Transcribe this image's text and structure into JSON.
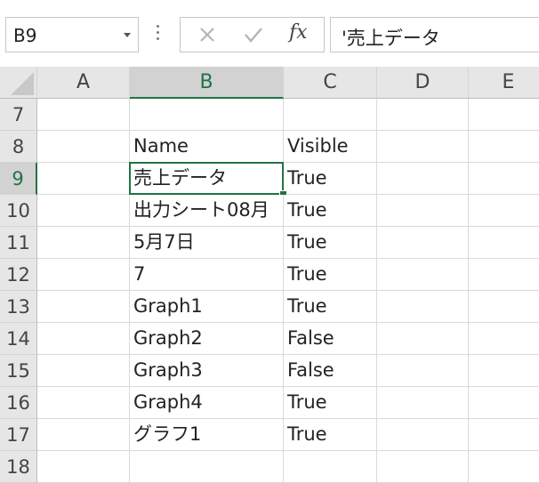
{
  "name_box": {
    "value": "B9"
  },
  "formula_bar": {
    "fx_label": "fx",
    "content": "'売上データ"
  },
  "columns": [
    {
      "label": "A"
    },
    {
      "label": "B"
    },
    {
      "label": "C"
    },
    {
      "label": "D"
    },
    {
      "label": "E"
    }
  ],
  "rows": [
    {
      "num": "7",
      "cells": [
        "",
        "",
        "",
        "",
        ""
      ]
    },
    {
      "num": "8",
      "cells": [
        "",
        "Name",
        "Visible",
        "",
        ""
      ]
    },
    {
      "num": "9",
      "cells": [
        "",
        "売上データ",
        "True",
        "",
        ""
      ]
    },
    {
      "num": "10",
      "cells": [
        "",
        "出力シート08月",
        "True",
        "",
        ""
      ]
    },
    {
      "num": "11",
      "cells": [
        "",
        "5月7日",
        "True",
        "",
        ""
      ]
    },
    {
      "num": "12",
      "cells": [
        "",
        "7",
        "True",
        "",
        ""
      ]
    },
    {
      "num": "13",
      "cells": [
        "",
        "Graph1",
        "True",
        "",
        ""
      ]
    },
    {
      "num": "14",
      "cells": [
        "",
        "Graph2",
        "False",
        "",
        ""
      ]
    },
    {
      "num": "15",
      "cells": [
        "",
        "Graph3",
        "False",
        "",
        ""
      ]
    },
    {
      "num": "16",
      "cells": [
        "",
        "Graph4",
        "True",
        "",
        ""
      ]
    },
    {
      "num": "17",
      "cells": [
        "",
        "グラフ1",
        "True",
        "",
        ""
      ]
    },
    {
      "num": "18",
      "cells": [
        "",
        "",
        "",
        "",
        ""
      ]
    }
  ],
  "selection": {
    "column": "B",
    "row": "9"
  },
  "colors": {
    "accent": "#217346",
    "header_bg": "#e6e6e6",
    "header_selected_bg": "#d2d2d2",
    "gridline": "#dadada"
  },
  "icons": {
    "cancel": "close-icon",
    "enter": "check-icon",
    "insert_function": "fx-icon",
    "name_box_dropdown": "chevron-down-icon"
  }
}
